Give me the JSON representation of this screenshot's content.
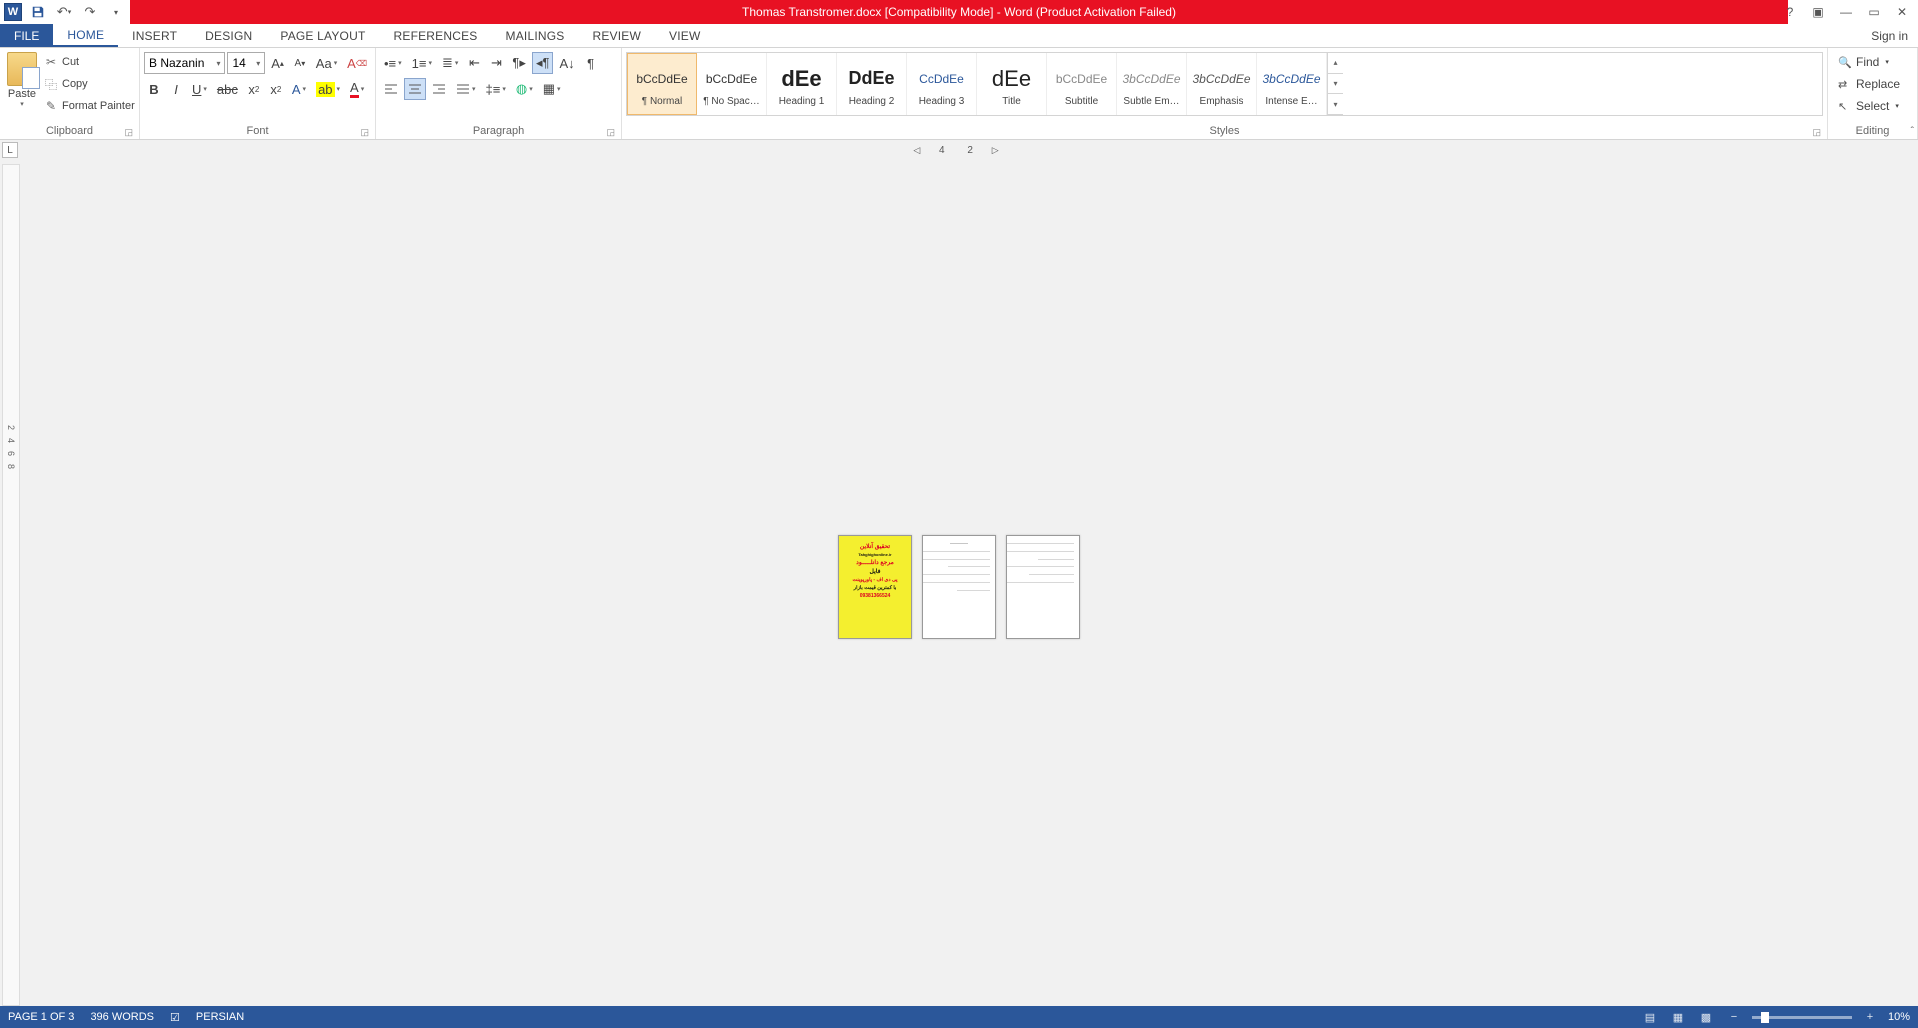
{
  "qat": {
    "undo": "↶",
    "redo": "↷",
    "save": "💾"
  },
  "title": "Thomas Transtromer.docx [Compatibility Mode] - Word (Product Activation Failed)",
  "tabs": {
    "file": "FILE",
    "home": "HOME",
    "insert": "INSERT",
    "design": "DESIGN",
    "page_layout": "PAGE LAYOUT",
    "references": "REFERENCES",
    "mailings": "MAILINGS",
    "review": "REVIEW",
    "view": "VIEW"
  },
  "signin": "Sign in",
  "clipboard": {
    "paste": "Paste",
    "cut": "Cut",
    "copy": "Copy",
    "format_painter": "Format Painter",
    "label": "Clipboard"
  },
  "font": {
    "name": "B Nazanin",
    "size": "14",
    "label": "Font"
  },
  "paragraph": {
    "label": "Paragraph"
  },
  "styles": {
    "label": "Styles",
    "items": [
      {
        "preview": "bCcDdEe",
        "name": "¶ Normal",
        "sel": true,
        "cls": ""
      },
      {
        "preview": "bCcDdEe",
        "name": "¶ No Spac…",
        "sel": false,
        "cls": ""
      },
      {
        "preview": "dEe",
        "name": "Heading 1",
        "sel": false,
        "cls": "font-size:22px;font-weight:bold;color:#222"
      },
      {
        "preview": "DdEe",
        "name": "Heading 2",
        "sel": false,
        "cls": "font-size:18px;font-weight:bold;color:#222"
      },
      {
        "preview": "CcDdEe",
        "name": "Heading 3",
        "sel": false,
        "cls": "color:#2b579a"
      },
      {
        "preview": "dEe",
        "name": "Title",
        "sel": false,
        "cls": "font-size:22px;color:#222"
      },
      {
        "preview": "bCcDdEe",
        "name": "Subtitle",
        "sel": false,
        "cls": "color:#888"
      },
      {
        "preview": "3bCcDdEe",
        "name": "Subtle Em…",
        "sel": false,
        "cls": "font-style:italic;color:#888"
      },
      {
        "preview": "3bCcDdEe",
        "name": "Emphasis",
        "sel": false,
        "cls": "font-style:italic;color:#555"
      },
      {
        "preview": "3bCcDdEe",
        "name": "Intense E…",
        "sel": false,
        "cls": "font-style:italic;color:#2b579a"
      }
    ]
  },
  "editing": {
    "find": "Find",
    "replace": "Replace",
    "select": "Select",
    "label": "Editing"
  },
  "hruler": [
    "4",
    "2"
  ],
  "vruler": [
    "2",
    "4",
    "6",
    "8"
  ],
  "cover": {
    "l1": "تحقیق آنلاین",
    "l2": "Tahghighonline.ir",
    "l3": "مرجع دانلـــــود",
    "l4": "فایل",
    "l5": "پی دی اف - پاورپوینت",
    "l6": "با کمترین قیمت بازار",
    "l7": "09381366524"
  },
  "status": {
    "page": "PAGE 1 OF 3",
    "words": "396 WORDS",
    "lang": "PERSIAN",
    "zoom": "10%"
  }
}
